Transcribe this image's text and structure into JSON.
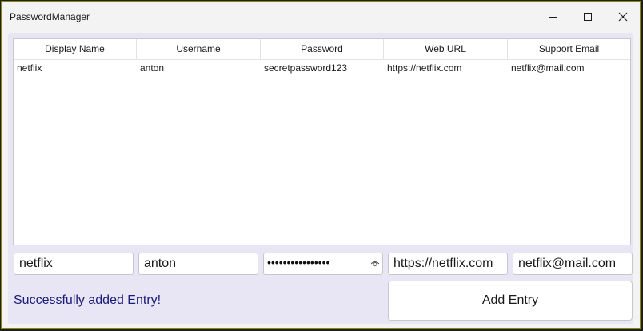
{
  "window": {
    "title": "PasswordManager"
  },
  "table": {
    "columns": [
      "Display Name",
      "Username",
      "Password",
      "Web URL",
      "Support Email"
    ],
    "rows": [
      [
        "netflix",
        "anton",
        "secretpassword123",
        "https://netflix.com",
        "netflix@mail.com"
      ]
    ]
  },
  "form": {
    "display_name": "netflix",
    "username": "anton",
    "password_masked": "••••••••••••••••",
    "web_url": "https://netflix.com",
    "support_email": "netflix@mail.com",
    "add_button_label": "Add Entry"
  },
  "status": {
    "message": "Successfully added Entry!",
    "color": "#1b1b78"
  },
  "icons": [
    "minimize-icon",
    "maximize-icon",
    "close-icon",
    "eye-icon"
  ]
}
